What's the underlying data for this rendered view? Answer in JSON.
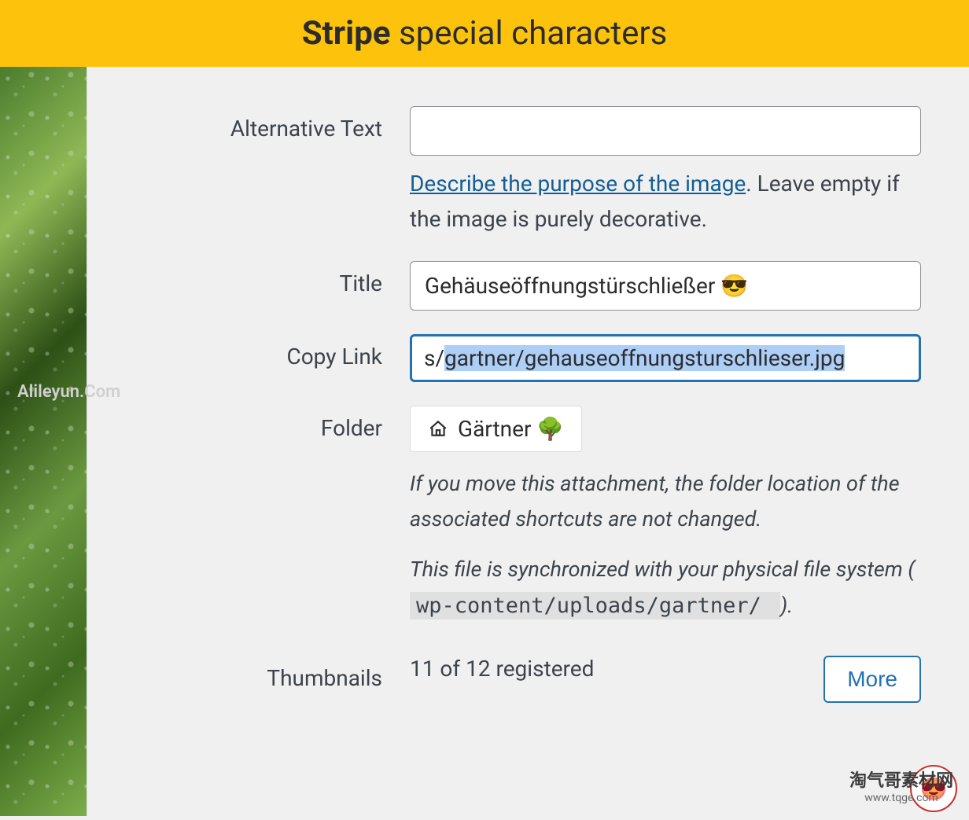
{
  "header": {
    "title_bold": "Stripe",
    "title_rest": " special characters"
  },
  "altText": {
    "label": "Alternative Text",
    "value": "",
    "helpLink": "Describe the purpose of the image",
    "helpRest": ". Leave empty if the image is purely decorative."
  },
  "title": {
    "label": "Title",
    "value": "Gehäuseöffnungstürschließer 😎"
  },
  "copyLink": {
    "label": "Copy Link",
    "prefix": "s/",
    "selected": "gartner/gehauseoffnungsturschlieser.jpg"
  },
  "folder": {
    "label": "Folder",
    "name": "Gärtner 🌳",
    "hint1": "If you move this attachment, the folder location of the associated shortcuts are not changed.",
    "hint2_pre": "This file is synchronized with your physical file system (",
    "hint2_code": " wp-content/uploads/gartner/ ",
    "hint2_post": ")."
  },
  "thumbnails": {
    "label": "Thumbnails",
    "value": "11 of 12 registered",
    "moreLabel": "More"
  },
  "watermarks": {
    "left": "Alileyun.Com",
    "right_cn": "淘气哥素材网",
    "right_url": "www.tqge.com"
  }
}
